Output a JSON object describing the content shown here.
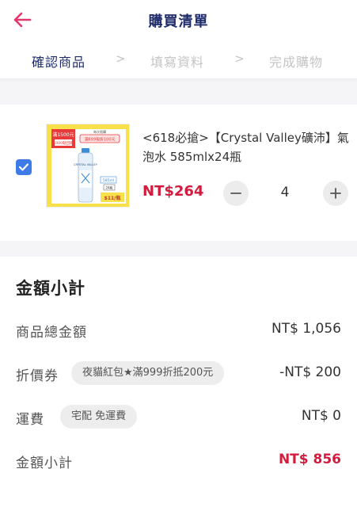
{
  "header": {
    "title": "購買清單",
    "back_icon": "arrow-left-icon",
    "accent_color": "#e4386c"
  },
  "steps": [
    {
      "label": "確認商品",
      "active": true
    },
    {
      "label": "填寫資料",
      "active": false
    },
    {
      "label": "完成購物",
      "active": false
    }
  ],
  "step_separator": ">",
  "product": {
    "checked": true,
    "name": "<618必搶>【Crystal Valley礦沛】氣泡水 585mlx24瓶",
    "price": "NT$264",
    "quantity": "4",
    "thumb_texts": {
      "promo_top": "滿1500元",
      "promo_sub": "1000點回饋",
      "promo_badge_top": "每次限購",
      "promo_badge": "滿699現折100元",
      "bottle_brand": "CRYSTAL VALLEY",
      "size_label": "585ml",
      "count_label": "24瓶",
      "unit_price_label": "$11/瓶"
    }
  },
  "summary": {
    "title": "金額小計",
    "rows": {
      "subtotal": {
        "label": "商品總金額",
        "value": "NT$ 1,056"
      },
      "coupon": {
        "label": "折價券",
        "chip": "夜貓紅包★滿999折抵200元",
        "value": "-NT$ 200"
      },
      "shipping": {
        "label": "運費",
        "chip": "宅配 免運費",
        "value": "NT$ 0"
      },
      "total": {
        "label": "金額小計",
        "value": "NT$ 856"
      }
    }
  },
  "colors": {
    "navy": "#1e2b6a",
    "price_red": "#d31b3d",
    "checkbox_blue": "#3f7be8",
    "inactive_step": "#c4c4c4"
  }
}
